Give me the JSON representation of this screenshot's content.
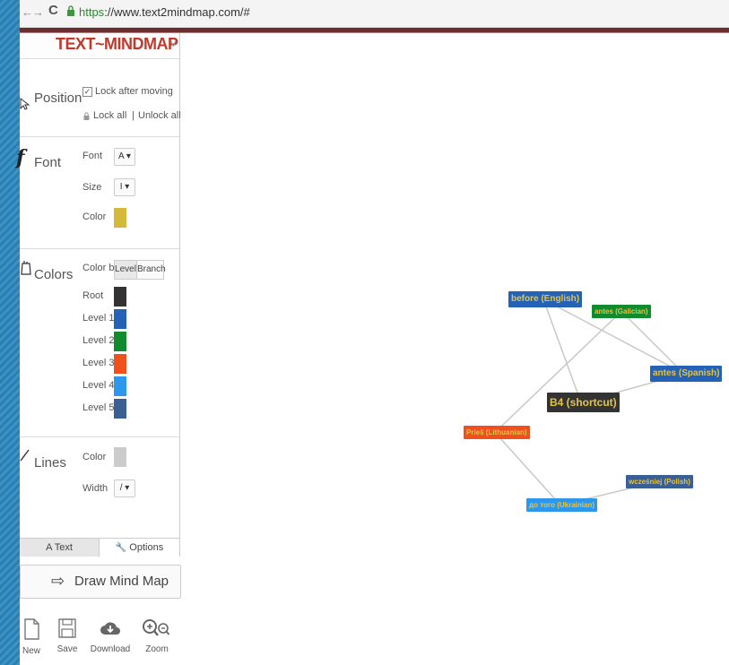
{
  "browser": {
    "back_glyph": "←",
    "forward_glyph": "→",
    "reload_glyph": "C",
    "url_scheme": "https",
    "url_rest": "://www.text2mindmap.com/#"
  },
  "logo": {
    "text": "TEXT~MINDMAP",
    "chevron": "v"
  },
  "position": {
    "title": "Position",
    "lock_after_moving": "Lock after moving",
    "lock_all": "Lock all",
    "separator": "|",
    "unlock_all": "Unlock all"
  },
  "font": {
    "title": "Font",
    "font_label": "Font",
    "font_value": "A ▾",
    "size_label": "Size",
    "size_value": "I ▾",
    "color_label": "Color",
    "color": "#d4b93a"
  },
  "colors": {
    "title": "Colors",
    "color_by_label": "Color by",
    "level_option": "Level",
    "branch_option": "Branch",
    "levels": [
      {
        "label": "Root",
        "color": "#333333"
      },
      {
        "label": "Level 1",
        "color": "#2462b8"
      },
      {
        "label": "Level 2",
        "color": "#128a2e"
      },
      {
        "label": "Level 3",
        "color": "#f0501e"
      },
      {
        "label": "Level 4",
        "color": "#2b98ee"
      },
      {
        "label": "Level 5",
        "color": "#3a5f94"
      }
    ]
  },
  "lines": {
    "title": "Lines",
    "color_label": "Color",
    "color": "#cccccc",
    "width_label": "Width",
    "width_value": "/ ▾"
  },
  "tabs": {
    "text": "A Text",
    "options": "Options"
  },
  "draw_button": "Draw Mind Map",
  "toolbar": {
    "new": "New",
    "save": "Save",
    "download": "Download",
    "zoom": "Zoom"
  },
  "mindmap": {
    "root": {
      "text": "B4 (shortcut)",
      "bg": "#333333",
      "fg": "#e2c44a"
    },
    "nodes": [
      {
        "text": "before (English)",
        "bg": "#2462b8",
        "fg": "#e2c44a"
      },
      {
        "text": "antes (Galician)",
        "bg": "#128a2e",
        "fg": "#e2c44a"
      },
      {
        "text": "antes (Spanish)",
        "bg": "#2462b8",
        "fg": "#e2c44a"
      },
      {
        "text": "Prieš (Lithuanian)",
        "bg": "#f0501e",
        "fg": "#e2c44a"
      },
      {
        "text": "до того (Ukrainian)",
        "bg": "#2b98ee",
        "fg": "#e2c44a"
      },
      {
        "text": "wcześniej (Polish)",
        "bg": "#3a5f94",
        "fg": "#e2c44a"
      }
    ],
    "line_color": "#c8c8c8"
  }
}
